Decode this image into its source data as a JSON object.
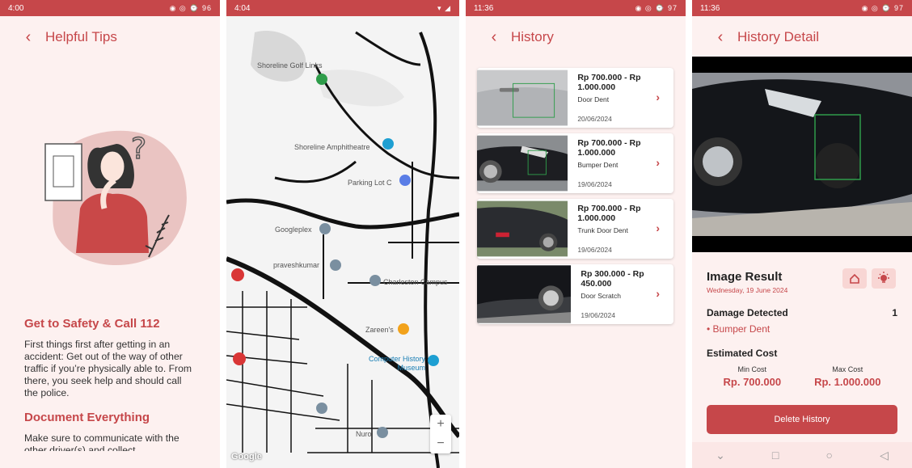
{
  "status": {
    "p1": {
      "time": "4:00",
      "right": "◉ ◎ ⌚ 96"
    },
    "p2": {
      "time": "4:04",
      "right": "▾ ◢"
    },
    "p3": {
      "time": "11:36",
      "right": "◉ ◎ ⌚ 97"
    },
    "p4": {
      "time": "11:36",
      "right": "◉ ◎ ⌚ 97"
    }
  },
  "tips": {
    "title": "Helpful Tips",
    "items": [
      {
        "heading": "Get to Safety & Call 112",
        "body": "First things first after getting in an accident: Get out of the way of other traffic if you’re physically able to. From there, you seek help and should call the police."
      },
      {
        "heading": "Document Everything",
        "body": "Make sure to communicate with the other driver(s) and collect"
      }
    ]
  },
  "map": {
    "labels": [
      "Shoreline Golf Links",
      "Shoreline Amphitheatre",
      "Parking Lot C",
      "Googleplex",
      "praveshkumar",
      "Charleston Campus",
      "Zareen's",
      "Computer History Museum",
      "Nuro"
    ],
    "attribution": "Google",
    "zoom_in": "+",
    "zoom_out": "−"
  },
  "history": {
    "title": "History",
    "items": [
      {
        "price": "Rp 700.000 - Rp 1.000.000",
        "type": "Door Dent",
        "date": "20/06/2024"
      },
      {
        "price": "Rp 700.000 - Rp 1.000.000",
        "type": "Bumper Dent",
        "date": "19/06/2024"
      },
      {
        "price": "Rp 700.000 - Rp 1.000.000",
        "type": "Trunk Door Dent",
        "date": "19/06/2024"
      },
      {
        "price": "Rp 300.000 - Rp 450.000",
        "type": "Door Scratch",
        "date": "19/06/2024"
      }
    ]
  },
  "detail": {
    "title": "History Detail",
    "image_result": "Image Result",
    "date": "Wednesday, 19 June 2024",
    "damage_detected_label": "Damage Detected",
    "damage_count": "1",
    "damage_item": "• Bumper Dent",
    "estimated_cost_label": "Estimated Cost",
    "min_label": "Min Cost",
    "min_value": "Rp. 700.000",
    "max_label": "Max Cost",
    "max_value": "Rp. 1.000.000",
    "delete_label": "Delete History",
    "nav": [
      "⌄",
      "□",
      "○",
      "◁"
    ]
  },
  "colors": {
    "accent": "#c6474a",
    "background": "#fdf1f0"
  }
}
